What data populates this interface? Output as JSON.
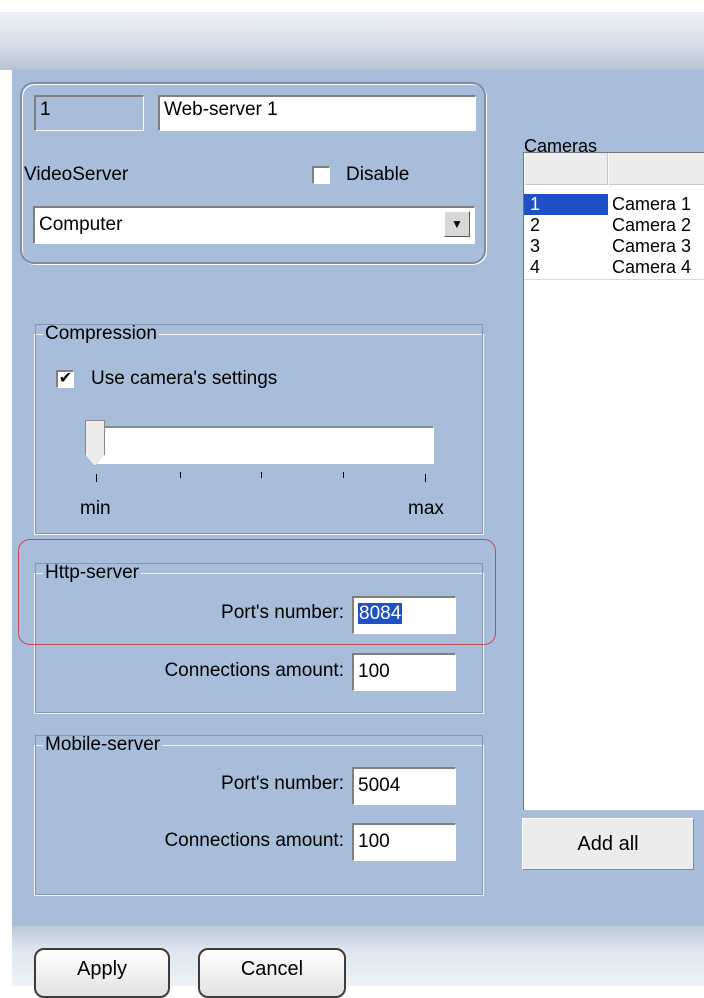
{
  "header": {
    "id": "1",
    "name": "Web-server 1"
  },
  "videoserver": {
    "label": "VideoServer",
    "disable_label": "Disable",
    "disable_checked": false,
    "computer_value": "Computer"
  },
  "compression": {
    "legend": "Compression",
    "use_camera_settings_label": "Use camera's settings",
    "use_camera_settings_checked": true,
    "min_label": "min",
    "max_label": "max",
    "slider_level": 0
  },
  "http_server": {
    "legend": "Http-server",
    "port_label": "Port's  number:",
    "port_value": "8084",
    "connections_label": "Connections amount:",
    "connections_value": "100"
  },
  "mobile_server": {
    "legend": "Mobile-server",
    "port_label": "Port's  number:",
    "port_value": "5004",
    "connections_label": "Connections amount:",
    "connections_value": "100"
  },
  "cameras": {
    "title": "Cameras",
    "rows": [
      {
        "num": "1",
        "name": "Camera 1"
      },
      {
        "num": "2",
        "name": "Camera 2"
      },
      {
        "num": "3",
        "name": "Camera 3"
      },
      {
        "num": "4",
        "name": "Camera 4"
      }
    ],
    "add_all_label": "Add all"
  },
  "footer": {
    "apply_label": "Apply",
    "cancel_label": "Cancel"
  },
  "colors": {
    "panel": "#a8bdd9",
    "selection": "#1f50c8",
    "highlight": "#c9474f"
  }
}
